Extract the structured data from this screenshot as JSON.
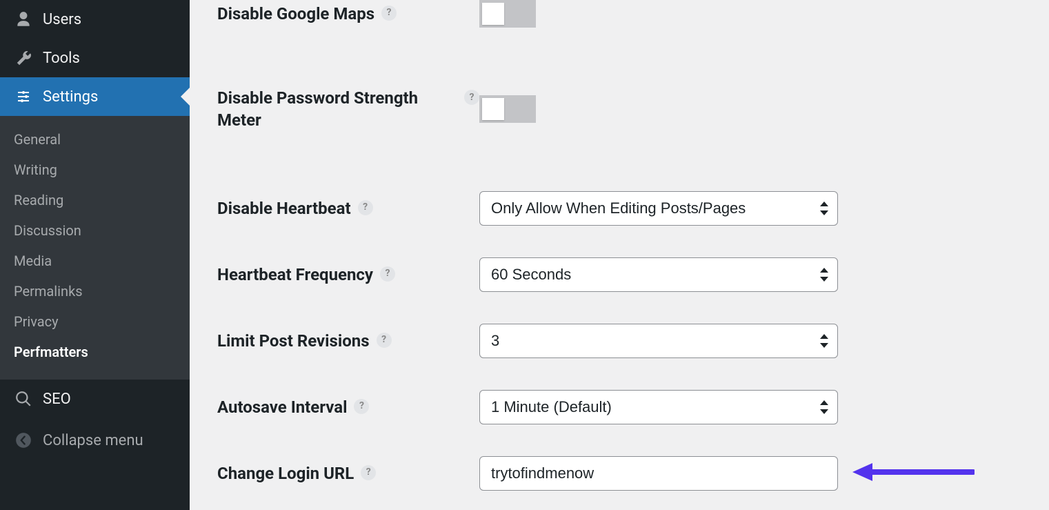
{
  "sidebar": {
    "items": [
      {
        "label": "Users"
      },
      {
        "label": "Tools"
      },
      {
        "label": "Settings"
      }
    ],
    "submenu": [
      "General",
      "Writing",
      "Reading",
      "Discussion",
      "Media",
      "Permalinks",
      "Privacy",
      "Perfmatters"
    ],
    "seo_label": "SEO",
    "collapse_label": "Collapse menu"
  },
  "settings": {
    "disable_google_maps": {
      "label": "Disable Google Maps",
      "value": false
    },
    "disable_password_meter": {
      "label": "Disable Password Strength Meter",
      "value": false
    },
    "disable_heartbeat": {
      "label": "Disable Heartbeat",
      "selected": "Only Allow When Editing Posts/Pages"
    },
    "heartbeat_frequency": {
      "label": "Heartbeat Frequency",
      "selected": "60 Seconds"
    },
    "limit_post_revisions": {
      "label": "Limit Post Revisions",
      "selected": "3"
    },
    "autosave_interval": {
      "label": "Autosave Interval",
      "selected": "1 Minute (Default)"
    },
    "change_login_url": {
      "label": "Change Login URL",
      "value": "trytofindmenow"
    }
  },
  "colors": {
    "accent": "#2271b1",
    "arrow": "#5333ed"
  }
}
